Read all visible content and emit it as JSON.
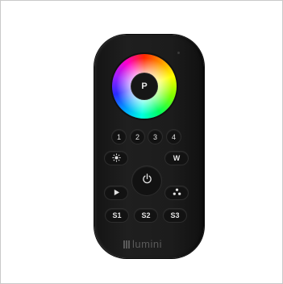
{
  "remote": {
    "center_label": "P",
    "number_keys": [
      "1",
      "2",
      "3",
      "4"
    ],
    "w_label": "W",
    "scene_keys": [
      "S1",
      "S2",
      "S3"
    ],
    "brand": "lumini",
    "icons": {
      "brightness": "sun-icon",
      "power": "power-icon",
      "play": "play-icon",
      "modes": "three-dots-icon"
    }
  }
}
